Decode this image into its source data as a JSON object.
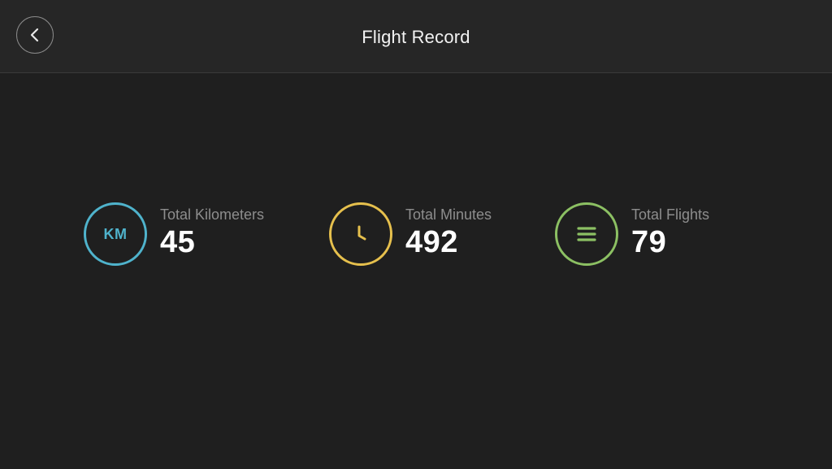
{
  "header": {
    "title": "Flight Record",
    "back_icon": "chevron-left-icon"
  },
  "stats": [
    {
      "label": "Total Kilometers",
      "value": "45",
      "icon": "km-icon",
      "icon_text": "KM",
      "color": "#4fb3cc"
    },
    {
      "label": "Total Minutes",
      "value": "492",
      "icon": "clock-icon",
      "color": "#e6c04d"
    },
    {
      "label": "Total Flights",
      "value": "79",
      "icon": "list-icon",
      "color": "#8cc063"
    }
  ]
}
